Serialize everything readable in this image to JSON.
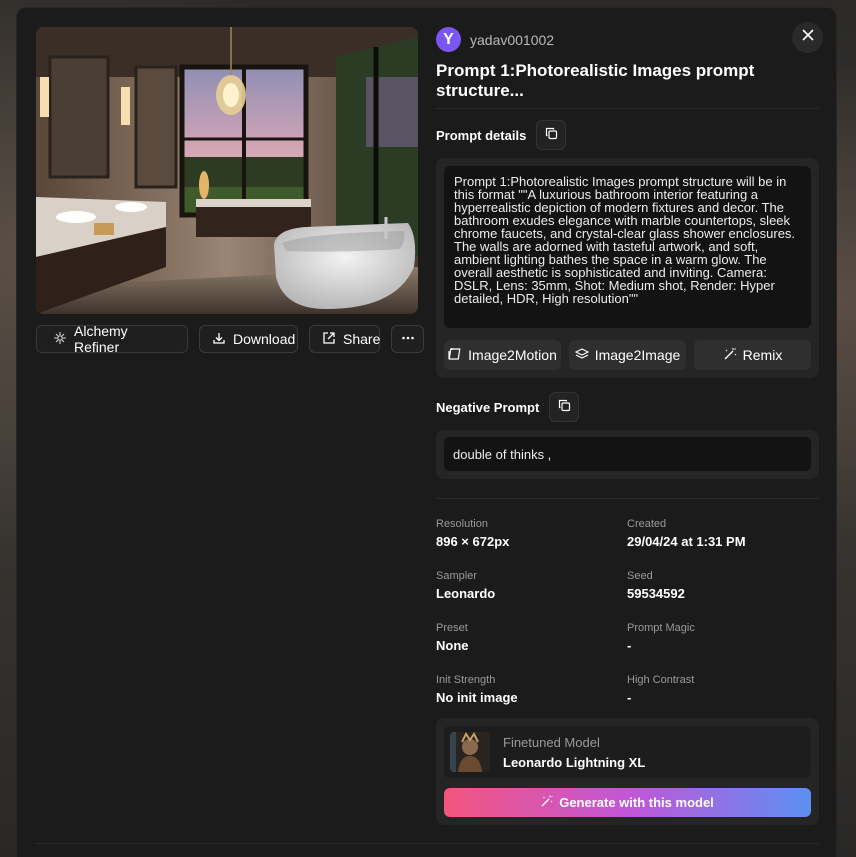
{
  "user": {
    "initial": "Y",
    "name": "yadav001002"
  },
  "title": "Prompt 1:Photorealistic Images prompt structure...",
  "prompt_details": {
    "label": "Prompt details",
    "text": "Prompt 1:Photorealistic Images prompt structure will be in this format \"\"A luxurious bathroom interior featuring a hyperrealistic depiction of modern fixtures and decor. The bathroom exudes elegance with marble countertops, sleek chrome faucets, and crystal-clear glass shower enclosures. The walls are adorned with tasteful artwork, and soft, ambient lighting bathes the space in a warm glow. The overall aesthetic is sophisticated and inviting. Camera: DSLR, Lens: 35mm, Shot: Medium shot, Render: Hyper detailed, HDR, High resolution\"\"",
    "actions": [
      "Image2Motion",
      "Image2Image",
      "Remix"
    ]
  },
  "negative_prompt": {
    "label": "Negative Prompt",
    "text": "double of thinks ,"
  },
  "image_actions": {
    "alchemy": "Alchemy Refiner",
    "download": "Download",
    "share": "Share"
  },
  "metadata": {
    "resolution": {
      "label": "Resolution",
      "value": "896 × 672px"
    },
    "created": {
      "label": "Created",
      "value": "29/04/24 at 1:31 PM"
    },
    "sampler": {
      "label": "Sampler",
      "value": "Leonardo"
    },
    "seed": {
      "label": "Seed",
      "value": "59534592"
    },
    "preset": {
      "label": "Preset",
      "value": "None"
    },
    "prompt_magic": {
      "label": "Prompt Magic",
      "value": "-"
    },
    "init_strength": {
      "label": "Init Strength",
      "value": "No init image"
    },
    "high_contrast": {
      "label": "High Contrast",
      "value": "-"
    }
  },
  "model": {
    "caption": "Finetuned Model",
    "name": "Leonardo Lightning XL",
    "generate_label": "Generate with this model"
  },
  "colors": {
    "avatar": "#7a57f0",
    "gradient_start": "#f2567e",
    "gradient_end": "#5c8ff2",
    "modal_bg": "#1b1b1b"
  },
  "icons": [
    "alchemy-icon",
    "download-icon",
    "share-icon",
    "more-icon",
    "close-icon",
    "copy-icon",
    "image2motion-icon",
    "image2image-icon",
    "remix-icon",
    "magic-wand-icon"
  ]
}
